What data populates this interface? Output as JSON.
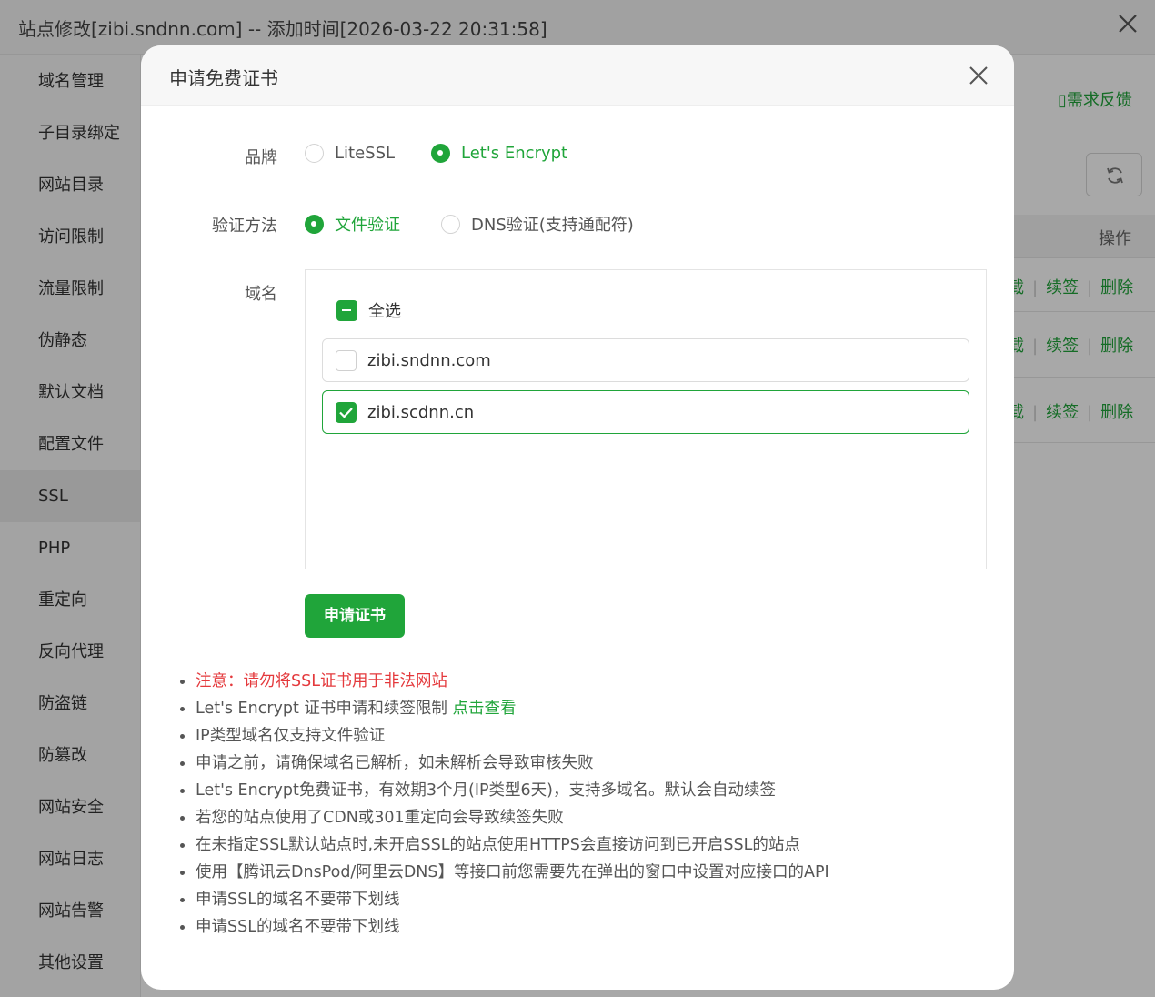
{
  "window": {
    "title": "站点修改[zibi.sndnn.com] -- 添加时间[2026-03-22 20:31:58]"
  },
  "sidebar": {
    "items": [
      {
        "label": "域名管理"
      },
      {
        "label": "子目录绑定"
      },
      {
        "label": "网站目录"
      },
      {
        "label": "访问限制"
      },
      {
        "label": "流量限制"
      },
      {
        "label": "伪静态"
      },
      {
        "label": "默认文档"
      },
      {
        "label": "配置文件"
      },
      {
        "label": "SSL",
        "active": true
      },
      {
        "label": "PHP"
      },
      {
        "label": "重定向"
      },
      {
        "label": "反向代理"
      },
      {
        "label": "防盗链"
      },
      {
        "label": "防篡改"
      },
      {
        "label": "网站安全"
      },
      {
        "label": "网站日志"
      },
      {
        "label": "网站告警"
      },
      {
        "label": "其他设置"
      }
    ]
  },
  "background": {
    "feedback": "需求反馈",
    "table_header_op": "操作",
    "rows": [
      {
        "renew": "续签",
        "delete": "删除"
      },
      {
        "renew": "续签",
        "delete": "删除"
      },
      {
        "renew": "续签",
        "delete": "删除"
      }
    ]
  },
  "modal": {
    "title": "申请免费证书",
    "brand": {
      "label": "品牌",
      "options": [
        "LiteSSL",
        "Let's Encrypt"
      ],
      "selected": "Let's Encrypt"
    },
    "verify": {
      "label": "验证方法",
      "options": [
        "文件验证",
        "DNS验证(支持通配符)"
      ],
      "selected": "文件验证"
    },
    "domain": {
      "label": "域名",
      "select_all": "全选",
      "select_all_state": "partial",
      "items": [
        {
          "name": "zibi.sndnn.com",
          "checked": false
        },
        {
          "name": "zibi.scdnn.cn",
          "checked": true
        }
      ]
    },
    "apply_button": "申请证书",
    "notes": {
      "warning": "注意：请勿将SSL证书用于非法网站",
      "limit_text": "Let's Encrypt 证书申请和续签限制 ",
      "limit_link": "点击查看",
      "items": [
        "IP类型域名仅支持文件验证",
        "申请之前，请确保域名已解析，如未解析会导致审核失败",
        "Let's Encrypt免费证书，有效期3个月(IP类型6天)，支持多域名。默认会自动续签",
        "若您的站点使用了CDN或301重定向会导致续签失败",
        "在未指定SSL默认站点时,未开启SSL的站点使用HTTPS会直接访问到已开启SSL的站点",
        "使用【腾讯云DnsPod/阿里云DNS】等接口前您需要先在弹出的窗口中设置对应接口的API",
        "申请SSL的域名不要带下划线",
        "申请SSL的域名不要带下划线"
      ]
    }
  },
  "colors": {
    "accent": "#20a53a",
    "warning": "#e4393c"
  }
}
